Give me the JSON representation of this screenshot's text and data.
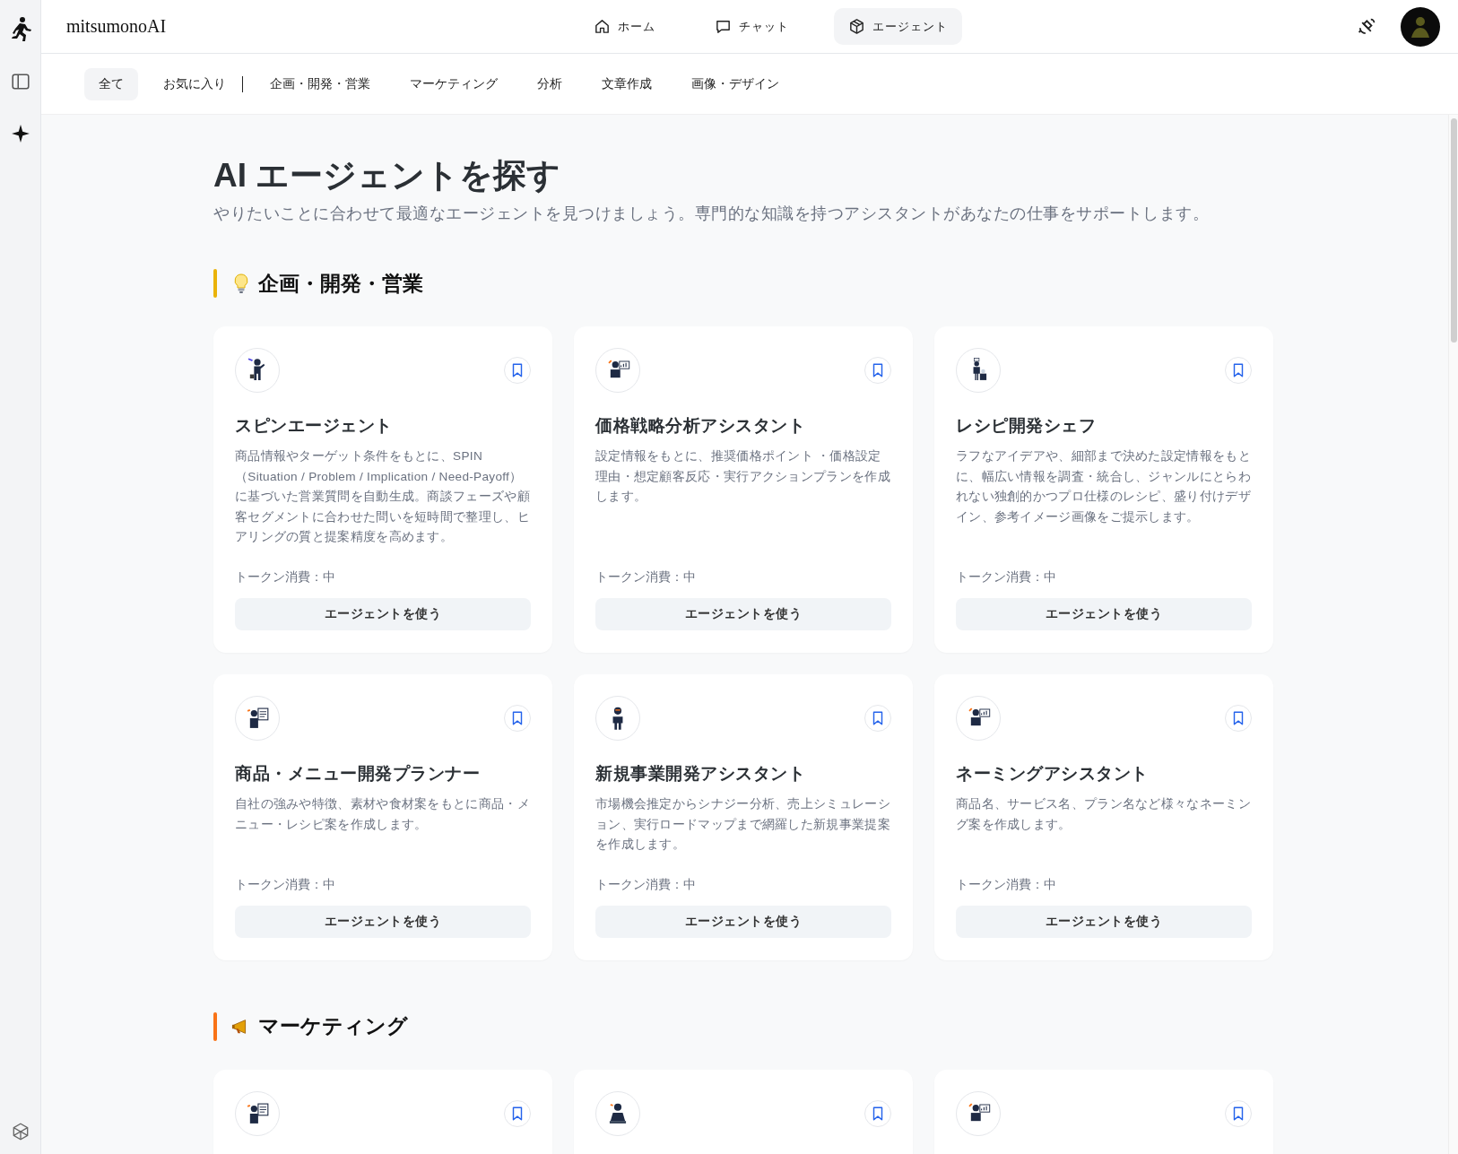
{
  "app": {
    "name": "mitsumonoAI"
  },
  "nav": [
    {
      "label": "ホーム",
      "selected": false
    },
    {
      "label": "チャット",
      "selected": false
    },
    {
      "label": "エージェント",
      "selected": true
    }
  ],
  "filters": [
    {
      "label": "全て",
      "selected": true,
      "divider_after": false
    },
    {
      "label": "お気に入り",
      "selected": false,
      "divider_after": true
    },
    {
      "label": "企画・開発・営業",
      "selected": false,
      "divider_after": false
    },
    {
      "label": "マーケティング",
      "selected": false,
      "divider_after": false
    },
    {
      "label": "分析",
      "selected": false,
      "divider_after": false
    },
    {
      "label": "文章作成",
      "selected": false,
      "divider_after": false
    },
    {
      "label": "画像・デザイン",
      "selected": false,
      "divider_after": false
    }
  ],
  "page": {
    "title": "AI エージェントを探す",
    "subtitle": "やりたいことに合わせて最適なエージェントを見つけましょう。専門的な知識を持つアシスタントがあなたの仕事をサポートします。"
  },
  "sections": [
    {
      "title": "企画・開発・営業",
      "color": "#eab308",
      "agents": [
        {
          "kind": "pointing",
          "name": "スピンエージェント",
          "description": "商品情報やターゲット条件をもとに、SPIN（Situation / Problem / Implication / Need-Payoff）に基づいた営業質問を自動生成。商談フェーズや顧客セグメントに合わせた問いを短時間で整理し、ヒアリングの質と提案精度を高めます。",
          "token": "トークン消費：中",
          "button": "エージェントを使う"
        },
        {
          "kind": "chart",
          "name": "価格戦略分析アシスタント",
          "description": "設定情報をもとに、推奨価格ポイント ・価格設定理由・想定顧客反応・実行アクションプランを作成します。",
          "token": "トークン消費：中",
          "button": "エージェントを使う"
        },
        {
          "kind": "chef",
          "name": "レシピ開発シェフ",
          "description": "ラフなアイデアや、細部まで決めた設定情報をもとに、幅広い情報を調査・統合し、ジャンルにとらわれない独創的かつプロ仕様のレシピ、盛り付けデザイン、参考イメージ画像をご提示します。",
          "token": "トークン消費：中",
          "button": "エージェントを使う"
        },
        {
          "kind": "board",
          "name": "商品・メニュー開発プランナー",
          "description": "自社の強みや特徴、素材や食材案をもとに商品・メニュー・レシピ案を作成します。",
          "token": "トークン消費：中",
          "button": "エージェントを使う"
        },
        {
          "kind": "standing",
          "name": "新規事業開発アシスタント",
          "description": "市場機会推定からシナジー分析、売上シミュレーション、実行ロードマップまで網羅した新規事業提案を作成します。",
          "token": "トークン消費：中",
          "button": "エージェントを使う"
        },
        {
          "kind": "chart",
          "name": "ネーミングアシスタント",
          "description": "商品名、サービス名、プラン名など様々なネーミング案を作成します。",
          "token": "トークン消費：中",
          "button": "エージェントを使う"
        }
      ]
    },
    {
      "title": "マーケティング",
      "color": "#f97316",
      "agents": [
        {
          "kind": "board"
        },
        {
          "kind": "sitting"
        },
        {
          "kind": "chart"
        }
      ]
    }
  ]
}
